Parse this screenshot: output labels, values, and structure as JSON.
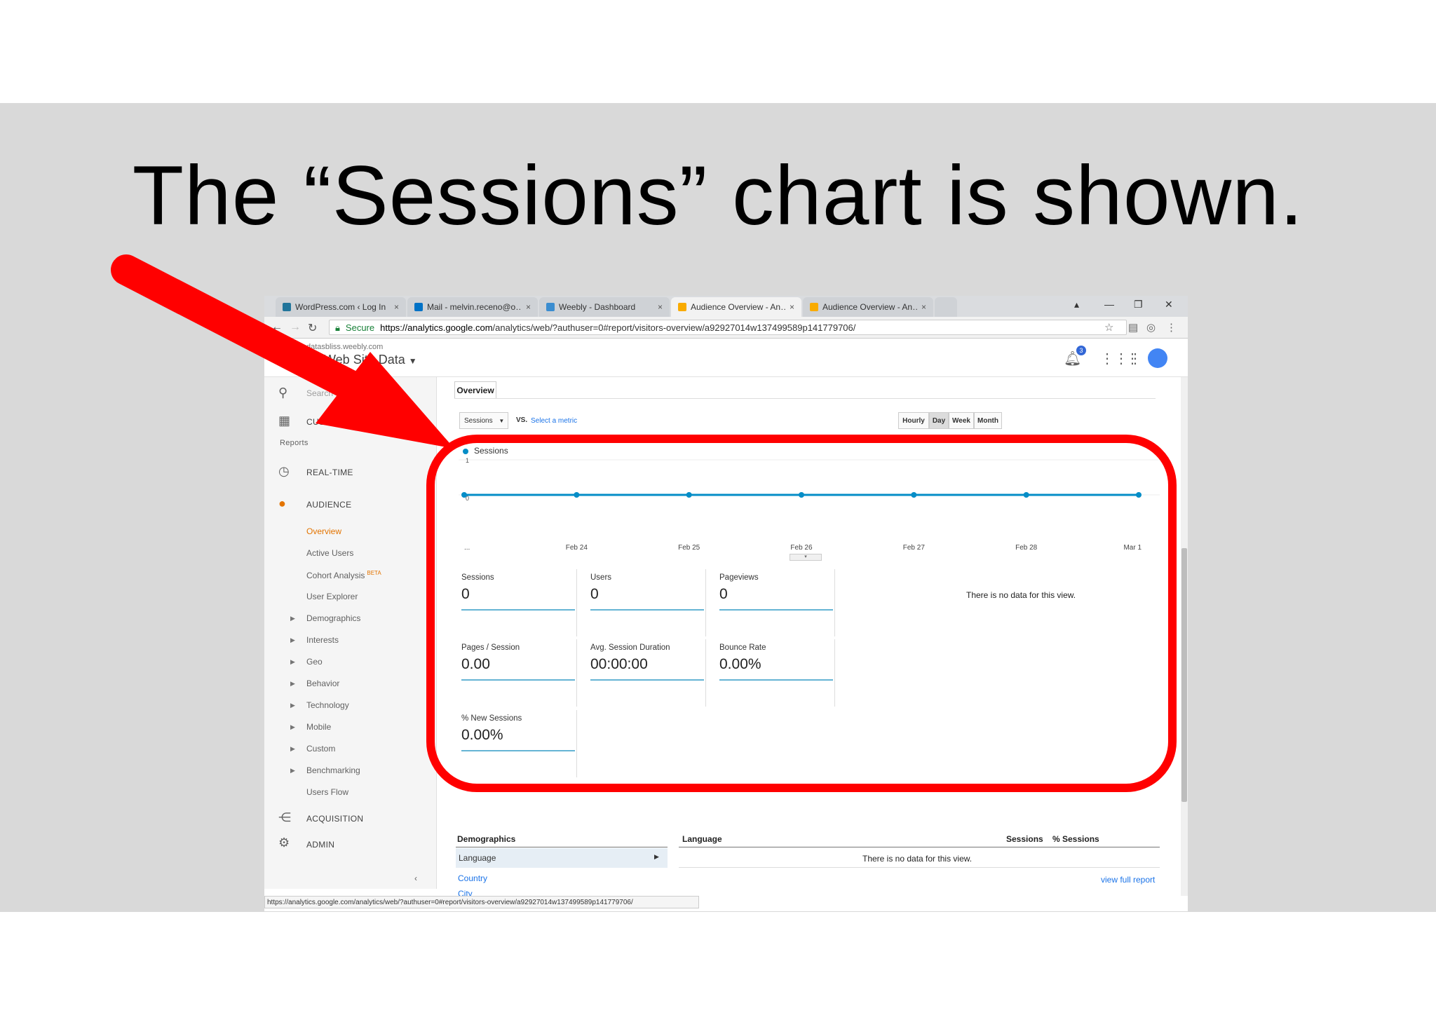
{
  "slide": {
    "title": "The “Sessions” chart is shown."
  },
  "colors": {
    "annotation_red": "#ff0000",
    "series_blue": "#058dc7",
    "orange_accent": "#e37400",
    "link_blue": "#1a73e8"
  },
  "browser": {
    "tabs": [
      {
        "label": "WordPress.com ‹ Log In",
        "icon": "wordpress-icon"
      },
      {
        "label": "Mail - melvin.receno@o…",
        "icon": "outlook-icon"
      },
      {
        "label": "Weebly - Dashboard",
        "icon": "weebly-icon"
      },
      {
        "label": "Audience Overview - An…",
        "icon": "analytics-icon"
      },
      {
        "label": "Audience Overview - An…",
        "icon": "analytics-icon"
      }
    ],
    "secure_label": "Secure",
    "url_host": "https://analytics.google.com",
    "url_path": "/analytics/web/?authuser=0#report/visitors-overview/a92927014w137499589p141779706/",
    "status_url": "https://analytics.google.com/analytics/web/?authuser=0#report/visitors-overview/a92927014w137499589p141779706/"
  },
  "ga_header": {
    "account_small": "datasbliss.weebly.com",
    "view_name": "All Web Site Data",
    "notification_count": "3"
  },
  "sidebar": {
    "search_placeholder": "Search",
    "customization": "CUSTOMIZATION",
    "reports_heading": "Reports",
    "realtime": "REAL-TIME",
    "audience": "AUDIENCE",
    "audience_items": [
      "Overview",
      "Active Users",
      "Cohort Analysis",
      "User Explorer",
      "Demographics",
      "Interests",
      "Geo",
      "Behavior",
      "Technology",
      "Mobile",
      "Custom",
      "Benchmarking",
      "Users Flow"
    ],
    "beta_label": "BETA",
    "acquisition": "ACQUISITION",
    "admin": "ADMIN"
  },
  "main": {
    "tab_label": "Overview",
    "metric_select": "Sessions",
    "vs_label": "VS.",
    "select_metric_link": "Select a metric",
    "granularity": [
      "Hourly",
      "Day",
      "Week",
      "Month"
    ],
    "granularity_selected": "Day",
    "no_data_right": "There is no data for this view."
  },
  "chart_data": {
    "type": "line",
    "series": [
      {
        "name": "Sessions",
        "values": [
          0,
          0,
          0,
          0,
          0,
          0,
          0
        ]
      }
    ],
    "x": [
      "...",
      "Feb 24",
      "Feb 25",
      "Feb 26",
      "Feb 27",
      "Feb 28",
      "Mar 1"
    ],
    "ylim": [
      0,
      1
    ],
    "y_ticks": [
      "1",
      "0"
    ]
  },
  "metrics": [
    {
      "label": "Sessions",
      "value": "0"
    },
    {
      "label": "Users",
      "value": "0"
    },
    {
      "label": "Pageviews",
      "value": "0"
    },
    {
      "label": "Pages / Session",
      "value": "0.00"
    },
    {
      "label": "Avg. Session Duration",
      "value": "00:00:00"
    },
    {
      "label": "Bounce Rate",
      "value": "0.00%"
    },
    {
      "label": "% New Sessions",
      "value": "0.00%"
    }
  ],
  "demographics": {
    "title": "Demographics",
    "language": "Language",
    "country": "Country",
    "city": "City"
  },
  "language_table": {
    "col_language": "Language",
    "col_sessions": "Sessions",
    "col_pct": "% Sessions",
    "no_data": "There is no data for this view.",
    "view_full": "view full report"
  }
}
